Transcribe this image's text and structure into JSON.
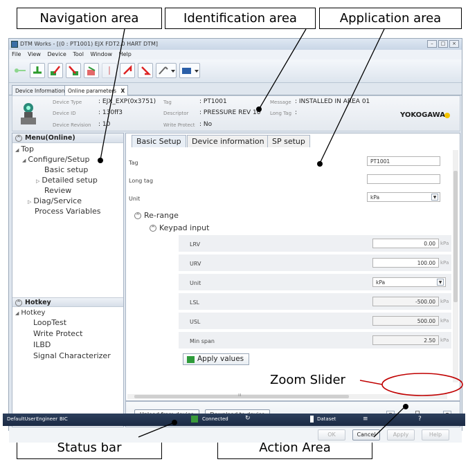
{
  "window": {
    "title": "DTM Works - [(0 : PT1001) EJX FDT2.0 HART DTM]",
    "menu": [
      "File",
      "View",
      "Device",
      "Tool",
      "Window",
      "Help"
    ]
  },
  "doc_tabs": [
    "Device Information",
    "Online parameters",
    "X"
  ],
  "identification": {
    "device_type_label": "Device Type",
    "device_type": "EJX_EXP(0x3751)",
    "device_id_label": "Device ID",
    "device_id": "130ff3",
    "device_revision_label": "Device Revision",
    "device_revision": "10",
    "tag_label": "Tag",
    "tag": "PT1001",
    "descriptor_label": "Descriptor",
    "descriptor": "PRESSURE REV 10",
    "write_protect_label": "Write Protect",
    "write_protect": "No",
    "message_label": "Message",
    "message": "INSTALLED IN AREA 01",
    "long_tag_label": "Long Tag",
    "long_tag": "",
    "brand": "YOKOGAWA"
  },
  "nav": {
    "menu_header": "Menu(Online)",
    "top": "Top",
    "configure": "Configure/Setup",
    "basic": "Basic setup",
    "detailed": "Detailed setup",
    "review": "Review",
    "diag": "Diag/Service",
    "process": "Process Variables",
    "hotkey_header": "Hotkey",
    "hotkey_root": "Hotkey",
    "looptest": "LoopTest",
    "write_protect": "Write Protect",
    "ilbd": "ILBD",
    "signal": "Signal Characterizer"
  },
  "app": {
    "tabs": [
      "Basic Setup",
      "Device information",
      "SP setup"
    ],
    "tag_label": "Tag",
    "tag_value": "PT1001",
    "long_tag_label": "Long tag",
    "long_tag_value": "",
    "unit_label": "Unit",
    "unit_value": "kPa",
    "rerange": "Re-range",
    "keypad": "Keypad input",
    "lrv_label": "LRV",
    "lrv_value": "0.00",
    "urv_label": "URV",
    "urv_value": "100.00",
    "unit2_label": "Unit",
    "unit2_value": "kPa",
    "lsl_label": "LSL",
    "lsl_value": "-500.00",
    "usl_label": "USL",
    "usl_value": "500.00",
    "minspan_label": "Min span",
    "minspan_value": "2.50",
    "unit_suffix": "kPa",
    "apply_values": "Apply values",
    "upload": "Upload from device",
    "download": "Download to device",
    "scroll_mark": "III"
  },
  "actions": {
    "ok": "OK",
    "cancel": "Cancel",
    "apply": "Apply",
    "help": "Help"
  },
  "status": {
    "user": "DefaultUser",
    "role": "Engineer",
    "mode": "BIC",
    "connection": "Connected",
    "dataset": "Dataset",
    "help_mark": "?"
  },
  "callouts": {
    "navigation": "Navigation area",
    "identification": "Identification area",
    "application": "Application area",
    "zoom": "Zoom Slider",
    "status": "Status bar",
    "action": "Action Area"
  },
  "colors": {
    "statusbar": "#1b2a44",
    "zoom_ring": "#c00000",
    "brand_dot": "#f5c400",
    "apply_icon": "#2e9b3a"
  }
}
